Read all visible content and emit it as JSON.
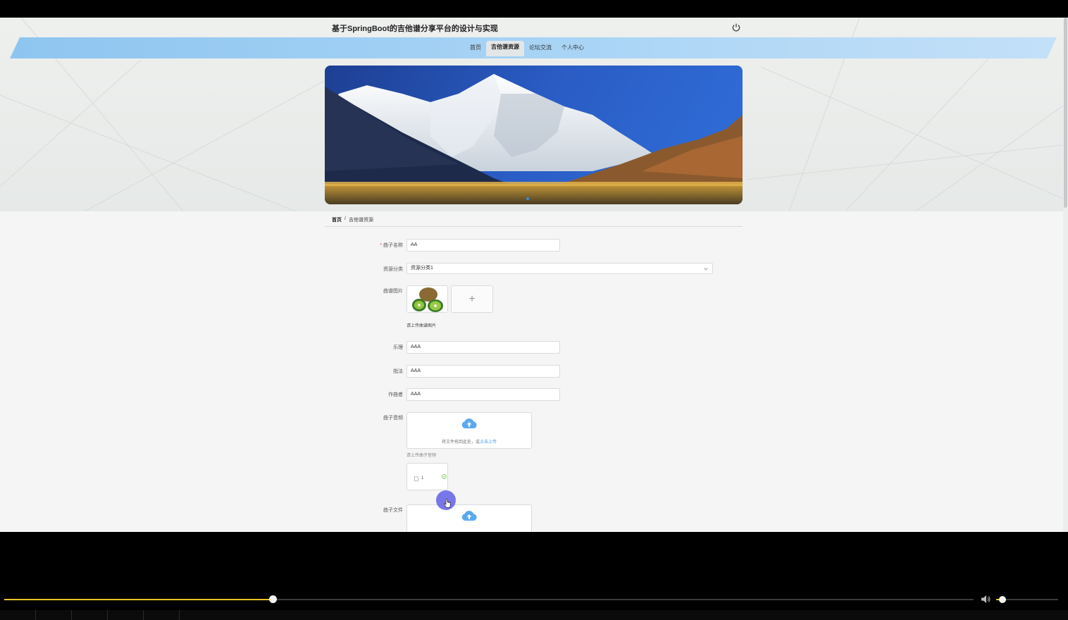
{
  "site": {
    "title": "基于SpringBoot的吉他谱分享平台的设计与实现"
  },
  "nav": [
    {
      "label": "首页",
      "active": false
    },
    {
      "label": "吉他谱资源",
      "active": true
    },
    {
      "label": "论坛交流",
      "active": false
    },
    {
      "label": "个人中心",
      "active": false
    }
  ],
  "breadcrumb": {
    "home": "首页",
    "separator": "/",
    "current": "吉他谱资源"
  },
  "form": {
    "song_name": {
      "label": "曲子名称",
      "required": true,
      "value": "AA"
    },
    "category": {
      "label": "资源分类",
      "value": "资源分类1"
    },
    "image": {
      "label": "曲谱图片",
      "hint": "请上传曲谱图片",
      "plus": "+"
    },
    "theory": {
      "label": "乐理",
      "value": "AAA"
    },
    "technique": {
      "label": "指法",
      "value": "AAA"
    },
    "composer": {
      "label": "作曲者",
      "value": "AAA"
    },
    "audio": {
      "label": "曲子音频",
      "drop_text": "将文件拖到此处，或",
      "drop_link": "点击上传",
      "hint": "请上传曲子音频",
      "file_name": "1"
    },
    "file": {
      "label": "曲子文件"
    }
  },
  "player": {
    "progress": 0.277,
    "volume": 0.1
  },
  "colors": {
    "accent": "#409eff",
    "nav_band": "#9fcdf2",
    "seek": "#e8c22a"
  }
}
